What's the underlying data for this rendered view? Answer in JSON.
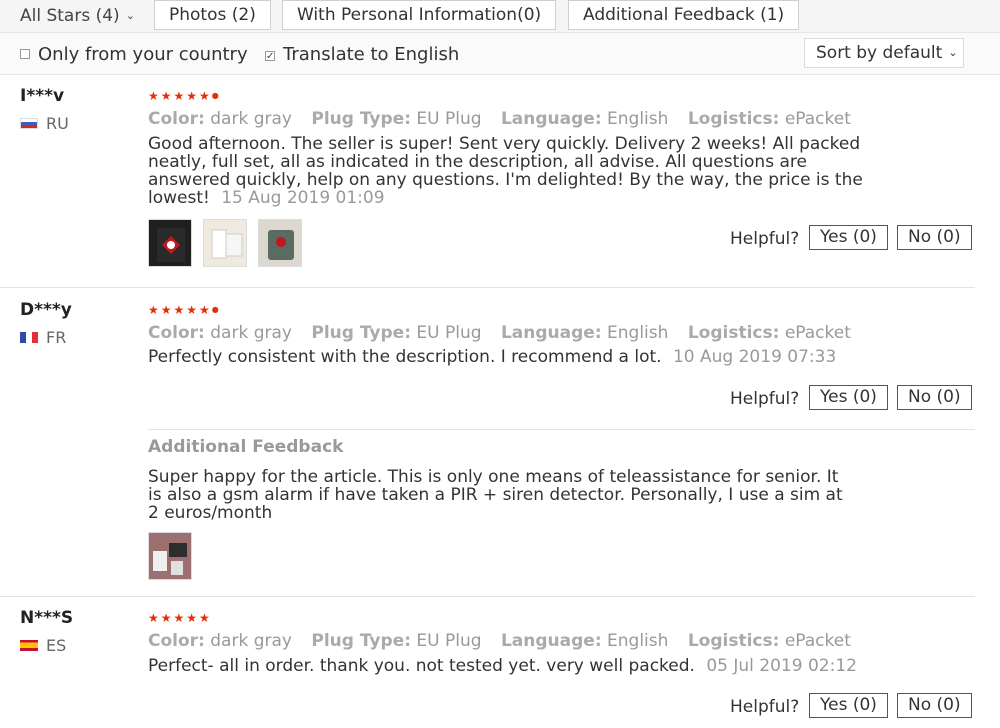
{
  "filters": {
    "stars_label": "All Stars (4)",
    "photos": "Photos (2)",
    "personal": "With Personal Information(0)",
    "additional": "Additional Feedback (1)",
    "only_country": "Only from your country",
    "translate": "Translate to English",
    "translate_checked": true,
    "sort": "Sort by default"
  },
  "labels": {
    "color": "Color:",
    "plug": "Plug Type:",
    "language": "Language:",
    "logistics": "Logistics:",
    "helpful": "Helpful?",
    "additional_feedback": "Additional Feedback"
  },
  "reviews": [
    {
      "user": "I***v",
      "country": "RU",
      "rating": 5,
      "color": "dark gray",
      "plug": "EU Plug",
      "language": "English",
      "logistics": "ePacket",
      "text": "Good afternoon. The seller is super! Sent very quickly. Delivery 2 weeks! All packed neatly, full set, all as indicated in the description, all advise. All questions are answered quickly, help on any questions. I'm delighted! By the way, the price is the lowest!",
      "date": "15 Aug 2019 01:09",
      "yes": "Yes (0)",
      "no": "No (0)"
    },
    {
      "user": "D***y",
      "country": "FR",
      "rating": 5,
      "color": "dark gray",
      "plug": "EU Plug",
      "language": "English",
      "logistics": "ePacket",
      "text": "Perfectly consistent with the description. I recommend a lot.",
      "date": "10 Aug 2019 07:33",
      "yes": "Yes (0)",
      "no": "No (0)",
      "additional_text": "Super happy for the article. This is only one means of teleassistance for senior. It is also a gsm alarm if have taken a PIR + siren detector. Personally, I use a sim at 2 euros/month"
    },
    {
      "user": "N***S",
      "country": "ES",
      "rating": 5,
      "color": "dark gray",
      "plug": "EU Plug",
      "language": "English",
      "logistics": "ePacket",
      "text": "Perfect- all in order. thank you. not tested yet. very well packed.",
      "date": "05 Jul 2019 02:12",
      "yes": "Yes (0)",
      "no": "No (0)"
    }
  ],
  "icons": {
    "chevron": "chevron-down-icon",
    "star": "star-icon",
    "checkbox": "checkbox-icon"
  },
  "colors": {
    "star": "#e62e04",
    "muted": "#999999"
  }
}
